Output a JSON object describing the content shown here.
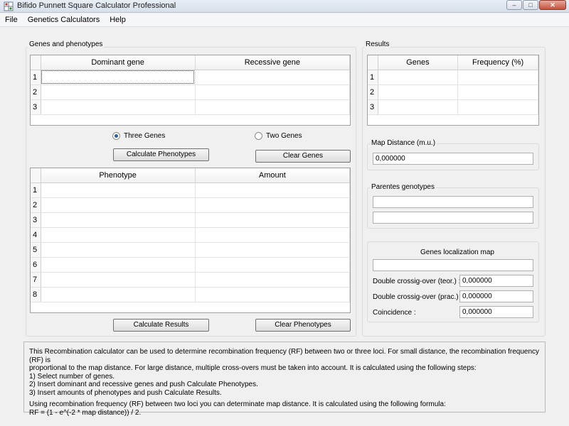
{
  "window": {
    "title": "Bifido Punnett Square Calculator Professional",
    "minimize": "–",
    "maximize": "□",
    "close": "✕"
  },
  "menu": [
    "File",
    "Genetics Calculators",
    "Help"
  ],
  "genes_group": {
    "label": "Genes and phenotypes",
    "genes_table": {
      "columns": [
        "Dominant gene",
        "Recessive gene"
      ],
      "row_numbers": [
        "1",
        "2",
        "3"
      ]
    },
    "radio_three": "Three Genes",
    "radio_two": "Two Genes",
    "selected_radio": "Three Genes",
    "calc_phenotypes_button": "Calculate Phenotypes",
    "clear_genes_button": "Clear Genes",
    "phenotype_table": {
      "columns": [
        "Phenotype",
        "Amount"
      ],
      "row_numbers": [
        "1",
        "2",
        "3",
        "4",
        "5",
        "6",
        "7",
        "8"
      ]
    },
    "calc_results_button": "Calculate Results",
    "clear_phenotypes_button": "Clear Phenotypes"
  },
  "results_group": {
    "label": "Results",
    "table": {
      "columns": [
        "Genes",
        "Frequency (%)"
      ],
      "row_numbers": [
        "1",
        "2",
        "3"
      ]
    },
    "map_distance_label": "Map Distance (m.u.)",
    "map_distance_value": "0,000000",
    "parents_label": "Parentes genotypes",
    "parents_values": [
      "",
      ""
    ],
    "localization_label": "Genes localization map",
    "localization_value": "",
    "double_teor_label": "Double crossig-over (teor.) :",
    "double_teor_value": "0,000000",
    "double_prac_label": "Double crossig-over (prac.) :",
    "double_prac_value": "0,000000",
    "coincidence_label": "Coincidence :",
    "coincidence_value": "0,000000"
  },
  "info": {
    "line1": "This Recombination calculator can be used to determine recombination frequency (RF) between two or three loci. For small distance, the recombination frequency (RF) is",
    "line2": "proportional to the map distance. For large distance, multiple cross-overs must be taken into account. It is calculated using the following steps:",
    "line3": "1) Select number of genes.",
    "line4": "2) Insert dominant and recessive genes and push Calculate Phenotypes.",
    "line5": "3) Insert amounts of phenotypes and push Calculate Results.",
    "line6": "Using recombination frequency (RF) between two loci you can determinate map distance. It is calculated using the following formula:",
    "line7": "RF = (1 - e^(-2 * map distance)) / 2."
  },
  "colors": {
    "accent": "#2a5f9e",
    "window_bg": "#f0f0f0"
  }
}
